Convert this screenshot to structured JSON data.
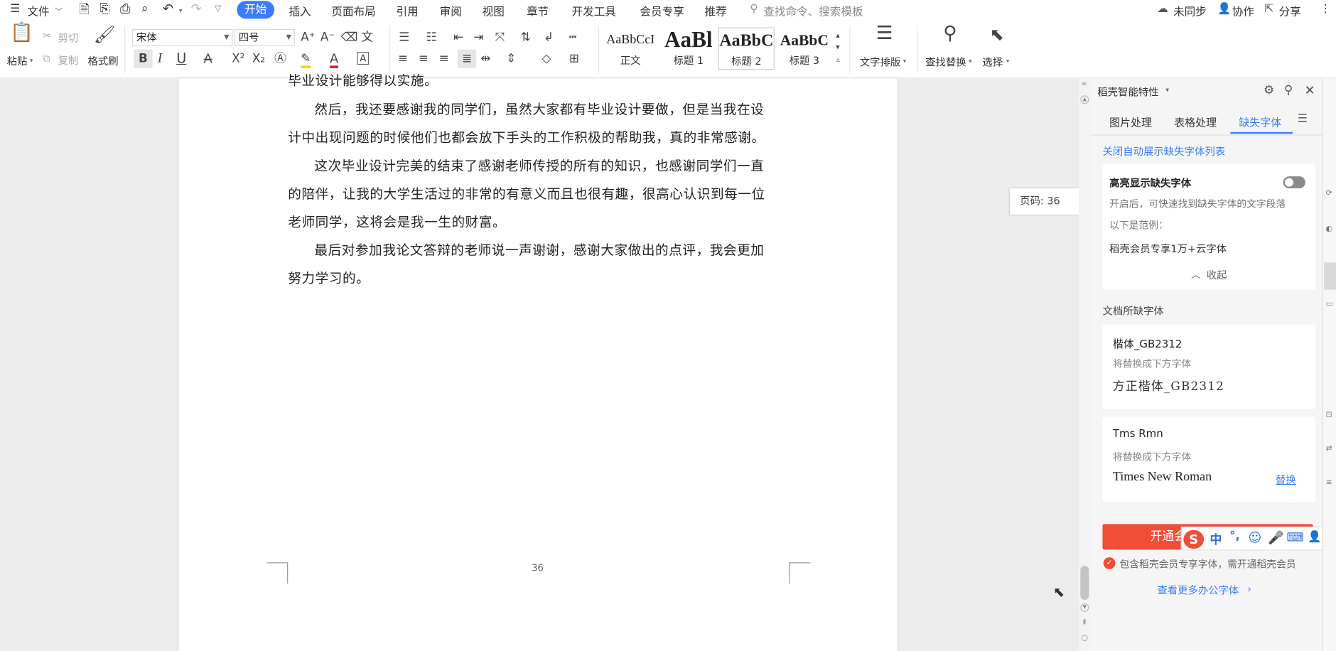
{
  "menubar": {
    "file": "文件",
    "tabs": [
      "开始",
      "插入",
      "页面布局",
      "引用",
      "审阅",
      "视图",
      "章节",
      "开发工具",
      "会员专享",
      "推荐"
    ],
    "search_placeholder": "查找命令、搜索模板",
    "sync": "未同步",
    "collab": "协作",
    "share": "分享"
  },
  "ribbon": {
    "paste": "粘贴",
    "cut": "剪切",
    "copy": "复制",
    "format_painter": "格式刷",
    "font_name": "宋体",
    "font_size": "四号",
    "styles": [
      {
        "preview": "AaBbCcI",
        "label": "正文"
      },
      {
        "preview": "AaBl",
        "label": "标题 1"
      },
      {
        "preview": "AaBbC",
        "label": "标题 2"
      },
      {
        "preview": "AaBbC",
        "label": "标题 3"
      }
    ],
    "text_layout": "文字排版",
    "find_replace": "查找替换",
    "select": "选择"
  },
  "document": {
    "top_line": "毕业设计能够得以实施。",
    "paragraphs": [
      [
        "然后，我还要感谢我的同学们，虽然大家都有毕业设计要做，但是当我在设",
        "计中出现问题的时候他们也都会放下手头的工作积极的帮助我，真的非常感谢。"
      ],
      [
        "这次毕业设计完美的结束了感谢老师传授的所有的知识，也感谢同学们一直",
        "的陪伴，让我的大学生活过的非常的有意义而且也很有趣，很高心认识到每一位",
        "老师同学，这将会是我一生的财富。"
      ],
      [
        "最后对参加我论文答辩的老师说一声谢谢，感谢大家做出的点评，我会更加",
        "努力学习的。"
      ]
    ],
    "page_number": "36",
    "page_tooltip": "页码: 36"
  },
  "panel": {
    "title": "稻壳智能特性",
    "tabs": [
      "图片处理",
      "表格处理",
      "缺失字体"
    ],
    "close_auto_link": "关闭自动展示缺失字体列表",
    "highlight_title": "高亮显示缺失字体",
    "highlight_desc": "开启后，可快速找到缺失字体的文字段落",
    "example_label": "以下是范例：",
    "example_text": "稻壳会员专享1万+云字体",
    "collapse": "收起",
    "missing_section": "文档所缺字体",
    "fonts": [
      {
        "name": "楷体_GB2312",
        "hint": "将替换成下方字体",
        "replacement": "方正楷体_GB2312",
        "action": ""
      },
      {
        "name": "Tms Rmn",
        "hint": "将替换成下方字体",
        "replacement": "Times New Roman",
        "action": "替换"
      }
    ],
    "vip_button": "开通会",
    "vip_note": "包含稻壳会员专享字体，需开通稻壳会员",
    "more_link": "查看更多办公字体"
  },
  "ime": {
    "lang": "中",
    "punct": "°,"
  },
  "colors": {
    "accent": "#3a7ef7",
    "vip": "#f04e36",
    "ime": "#2f6fe0"
  }
}
